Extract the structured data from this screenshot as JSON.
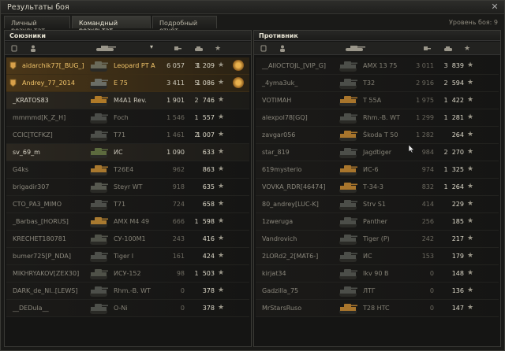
{
  "window": {
    "title": "Результаты боя",
    "close": "✕"
  },
  "tabs": [
    "Личный результат",
    "Командный результат",
    "Подробный отчёт"
  ],
  "level_text": "Уровень боя: 9",
  "allies": {
    "title": "Союзники",
    "rows": [
      {
        "name": "aidarchik77[_BUG_]",
        "vehicle": "Leopard PT A",
        "damage": "6 057",
        "kills": "3",
        "xp": "1 209",
        "hl": true,
        "medal": true,
        "tank": "#6a6a5a"
      },
      {
        "name": "Andrey_77_2014",
        "vehicle": "E 75",
        "damage": "3 411",
        "kills": "5",
        "xp": "1 086",
        "hl": true,
        "medal": true,
        "tank": "#6b6e66"
      },
      {
        "name": "_KRATOS83",
        "vehicle": "M4A1 Rev.",
        "damage": "1 901",
        "kills": "2",
        "xp": "746",
        "tank": "#b07a28"
      },
      {
        "name": "mmmmd[K_Z_H]",
        "vehicle": "Foch",
        "damage": "1 546",
        "kills": "1",
        "xp": "557",
        "dead": true,
        "tank": "#4a4c48"
      },
      {
        "name": "CCIC[TCFKZ]",
        "vehicle": "T71",
        "damage": "1 461",
        "kills": "2",
        "xp": "1 007",
        "dead": true,
        "tank": "#4d4f4a"
      },
      {
        "name": "sv_69_m",
        "vehicle": "ИС",
        "damage": "1 090",
        "kills": "",
        "xp": "633",
        "tank": "#5c6a3e"
      },
      {
        "name": "G4ks",
        "vehicle": "T26E4",
        "damage": "962",
        "kills": "",
        "xp": "863",
        "dead": true,
        "tank": "#a8782e"
      },
      {
        "name": "brigadir307",
        "vehicle": "Steyr WT",
        "damage": "918",
        "kills": "",
        "xp": "635",
        "dead": true,
        "tank": "#56584f"
      },
      {
        "name": "CTO_PA3_MIMO",
        "vehicle": "T71",
        "damage": "724",
        "kills": "",
        "xp": "658",
        "dead": true,
        "tank": "#4d4f4a"
      },
      {
        "name": "_Barbas_[HORUS]",
        "vehicle": "AMX M4 49",
        "damage": "666",
        "kills": "1",
        "xp": "598",
        "dead": true,
        "tank": "#a97a30"
      },
      {
        "name": "KRECHET180781",
        "vehicle": "СУ-100М1",
        "damage": "243",
        "kills": "",
        "xp": "416",
        "dead": true,
        "tank": "#4f5148"
      },
      {
        "name": "bumer725[P_NDA]",
        "vehicle": "Tiger I",
        "damage": "161",
        "kills": "",
        "xp": "424",
        "dead": true,
        "tank": "#4d4f4a"
      },
      {
        "name": "MIKHRYAKOV[ZEX30]",
        "vehicle": "ИСУ-152",
        "damage": "98",
        "kills": "1",
        "xp": "503",
        "dead": true,
        "tank": "#4f5148"
      },
      {
        "name": "DARK_de_NI..[LEWS]",
        "vehicle": "Rhm.-B. WT",
        "damage": "0",
        "kills": "",
        "xp": "378",
        "dead": true,
        "tank": "#4d4f4a"
      },
      {
        "name": "__DEDula__",
        "vehicle": "O-Ni",
        "damage": "0",
        "kills": "",
        "xp": "378",
        "dead": true,
        "tank": "#4d4f4a"
      }
    ]
  },
  "enemies": {
    "title": "Противник",
    "rows": [
      {
        "name": "__AlIOCTOJL_[VIP_G]",
        "vehicle": "AMX 13 75",
        "damage": "3 011",
        "kills": "3",
        "xp": "839",
        "dead": true,
        "tank": "#4c4e49"
      },
      {
        "name": "_4yma3uk_",
        "vehicle": "T32",
        "damage": "2 916",
        "kills": "2",
        "xp": "594",
        "dead": true,
        "tank": "#4c4e49"
      },
      {
        "name": "VOTIMAH",
        "vehicle": "T 55A",
        "damage": "1 975",
        "kills": "1",
        "xp": "422",
        "dead": true,
        "tank": "#a8752c"
      },
      {
        "name": "alexpol78[GQ]",
        "vehicle": "Rhm.-B. WT",
        "damage": "1 299",
        "kills": "1",
        "xp": "281",
        "dead": true,
        "tank": "#4c4e49"
      },
      {
        "name": "zavgar056",
        "vehicle": "Škoda T 50",
        "damage": "1 282",
        "kills": "",
        "xp": "264",
        "dead": true,
        "tank": "#a8752c"
      },
      {
        "name": "star_819",
        "vehicle": "Jagdtiger",
        "damage": "984",
        "kills": "2",
        "xp": "270",
        "dead": true,
        "tank": "#4c4e49"
      },
      {
        "name": "619mysterio",
        "vehicle": "ИС-6",
        "damage": "974",
        "kills": "1",
        "xp": "325",
        "dead": true,
        "tank": "#a8752c"
      },
      {
        "name": "VOVKA_RDR[46474]",
        "vehicle": "Т-34-3",
        "damage": "832",
        "kills": "1",
        "xp": "264",
        "dead": true,
        "tank": "#a8752c"
      },
      {
        "name": "80_andrey[LUC-K]",
        "vehicle": "Strv S1",
        "damage": "414",
        "kills": "",
        "xp": "229",
        "dead": true,
        "tank": "#4c4e49"
      },
      {
        "name": "1zweruga",
        "vehicle": "Panther",
        "damage": "256",
        "kills": "",
        "xp": "185",
        "dead": true,
        "tank": "#4c4e49"
      },
      {
        "name": "Vandrovich",
        "vehicle": "Tiger (P)",
        "damage": "242",
        "kills": "",
        "xp": "217",
        "dead": true,
        "tank": "#4c4e49"
      },
      {
        "name": "2LORd2_2[MAT6-]",
        "vehicle": "ИС",
        "damage": "153",
        "kills": "",
        "xp": "179",
        "dead": true,
        "tank": "#4c4e49"
      },
      {
        "name": "kirjat34",
        "vehicle": "Ikv 90 B",
        "damage": "0",
        "kills": "",
        "xp": "148",
        "dead": true,
        "tank": "#4c4e49"
      },
      {
        "name": "Gadzilla_75",
        "vehicle": "ЛТГ",
        "damage": "0",
        "kills": "",
        "xp": "136",
        "dead": true,
        "tank": "#4c4e49"
      },
      {
        "name": "MrStarsRuso",
        "vehicle": "T28 HTC",
        "damage": "0",
        "kills": "",
        "xp": "147",
        "dead": true,
        "tank": "#a8752c"
      }
    ]
  },
  "icons": {
    "star": "★",
    "sort": "▾"
  }
}
